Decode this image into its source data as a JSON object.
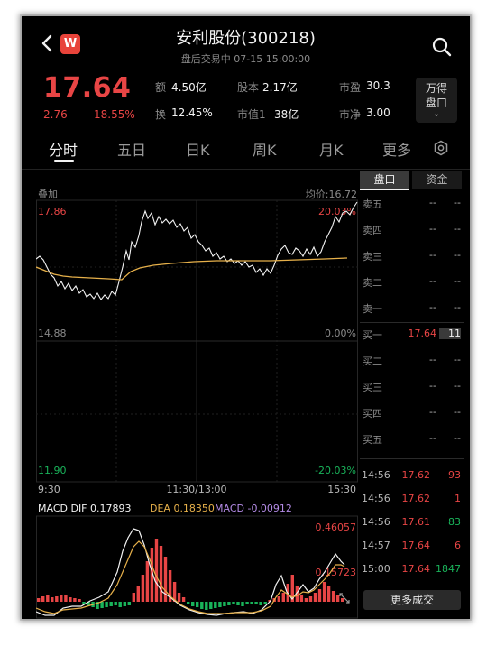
{
  "header": {
    "logo": "W",
    "title": "安利股份(300218)",
    "subtitle": "盘后交易中  07-15 15:00:00"
  },
  "quote": {
    "price": "17.64",
    "change": "2.76",
    "change_pct": "18.55%",
    "stats": [
      {
        "k": "额",
        "v": "4.50亿"
      },
      {
        "k": "股本",
        "v": "2.17亿"
      },
      {
        "k": "市盈",
        "v": "30.3"
      },
      {
        "k": "换",
        "v": "12.45%"
      },
      {
        "k": "市值1",
        "v": "38亿"
      },
      {
        "k": "市净",
        "v": "3.00"
      }
    ],
    "wande_line1": "万得",
    "wande_line2": "盘口"
  },
  "tabs": [
    "分时",
    "五日",
    "日K",
    "周K",
    "月K",
    "更多"
  ],
  "chart": {
    "overlay_label": "叠加",
    "avg_label": "均价:16.72",
    "y_high": "17.86",
    "y_mid": "14.88",
    "y_low": "11.90",
    "pct_high": "20.03%",
    "pct_mid": "0.00%",
    "pct_low": "-20.03%",
    "x_start": "9:30",
    "x_mid": "11:30/13:00",
    "x_end": "15:30",
    "macd_dif": "MACD DIF 0.17893",
    "macd_dea": "DEA 0.18350",
    "macd_val": "MACD -0.00912",
    "macd_high": "0.46057",
    "macd_mid": "0.15723",
    "colors": {
      "price": "#f2f2f2",
      "avg": "#e6b04a",
      "up": "#e84545",
      "down": "#19b35a",
      "dea": "#e6b04a",
      "macd": "#b48be6"
    }
  },
  "order_book": {
    "tab_active": "盘口",
    "tab_other": "资金",
    "sells": [
      {
        "lab": "卖五",
        "p": "--",
        "v": "--"
      },
      {
        "lab": "卖四",
        "p": "--",
        "v": "--"
      },
      {
        "lab": "卖三",
        "p": "--",
        "v": "--"
      },
      {
        "lab": "卖二",
        "p": "--",
        "v": "--"
      },
      {
        "lab": "卖一",
        "p": "--",
        "v": "--"
      }
    ],
    "buys": [
      {
        "lab": "买一",
        "p": "17.64",
        "v": "11"
      },
      {
        "lab": "买二",
        "p": "--",
        "v": "--"
      },
      {
        "lab": "买三",
        "p": "--",
        "v": "--"
      },
      {
        "lab": "买四",
        "p": "--",
        "v": "--"
      },
      {
        "lab": "买五",
        "p": "--",
        "v": "--"
      }
    ],
    "trades": [
      {
        "t": "14:56",
        "p": "17.62",
        "v": "93",
        "dir": "up"
      },
      {
        "t": "14:56",
        "p": "17.62",
        "v": "1",
        "dir": "up"
      },
      {
        "t": "14:56",
        "p": "17.61",
        "v": "83",
        "dir": "down"
      },
      {
        "t": "14:57",
        "p": "17.64",
        "v": "6",
        "dir": "up"
      },
      {
        "t": "15:00",
        "p": "17.64",
        "v": "1847",
        "dir": "down"
      }
    ],
    "more_label": "更多成交"
  }
}
